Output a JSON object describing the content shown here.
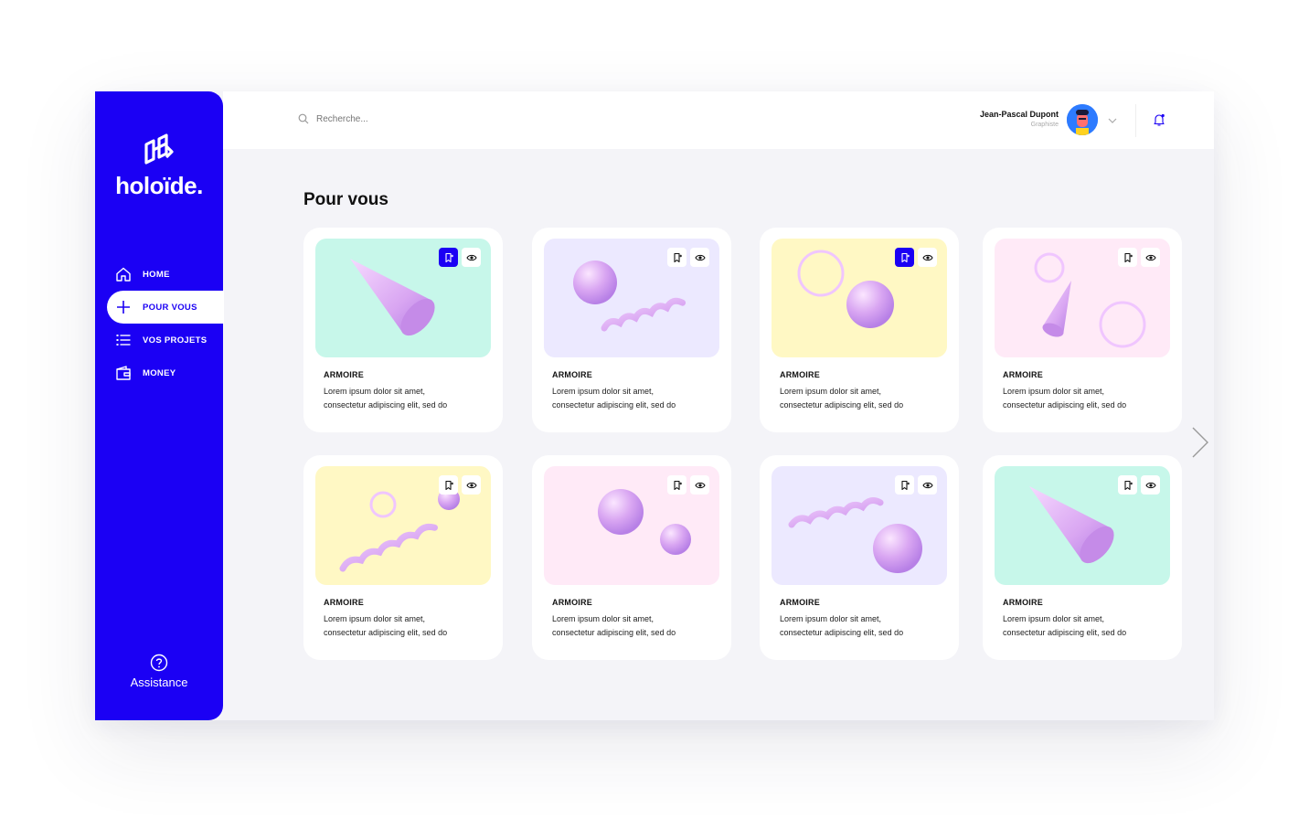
{
  "sidebar": {
    "logo_text": "holoïde.",
    "items": [
      {
        "label": "HOME",
        "icon": "home-icon",
        "active": false
      },
      {
        "label": "POUR VOUS",
        "icon": "plus-icon",
        "active": true
      },
      {
        "label": "VOS PROJETS",
        "icon": "list-icon",
        "active": false
      },
      {
        "label": "MONEY",
        "icon": "wallet-icon",
        "active": false
      }
    ],
    "assistance_label": "Assistance"
  },
  "header": {
    "search_placeholder": "Recherche...",
    "user_name": "Jean-Pascal Dupont",
    "user_role": "Graphiste"
  },
  "main": {
    "title": "Pour vous",
    "cards": [
      {
        "title": "ARMOIRE",
        "line1": "Lorem ipsum dolor sit amet,",
        "line2": "consectetur adipiscing elit, sed do",
        "bg": "#c7f7ea",
        "art": "cone",
        "saved": true
      },
      {
        "title": "ARMOIRE",
        "line1": "Lorem ipsum dolor sit amet,",
        "line2": "consectetur adipiscing elit, sed do",
        "bg": "#ece9ff",
        "art": "sphere-spiral",
        "saved": false
      },
      {
        "title": "ARMOIRE",
        "line1": "Lorem ipsum dolor sit amet,",
        "line2": "consectetur adipiscing elit, sed do",
        "bg": "#fff8c4",
        "art": "ring-sphere",
        "saved": true
      },
      {
        "title": "ARMOIRE",
        "line1": "Lorem ipsum dolor sit amet,",
        "line2": "consectetur adipiscing elit, sed do",
        "bg": "#ffeaf7",
        "art": "small-cone-rings",
        "saved": false
      },
      {
        "title": "ARMOIRE",
        "line1": "Lorem ipsum dolor sit amet,",
        "line2": "consectetur adipiscing elit, sed do",
        "bg": "#fff8c4",
        "art": "ring-spiral",
        "saved": false
      },
      {
        "title": "ARMOIRE",
        "line1": "Lorem ipsum dolor sit amet,",
        "line2": "consectetur adipiscing elit, sed do",
        "bg": "#ffeaf7",
        "art": "two-spheres",
        "saved": false
      },
      {
        "title": "ARMOIRE",
        "line1": "Lorem ipsum dolor sit amet,",
        "line2": "consectetur adipiscing elit, sed do",
        "bg": "#ece9ff",
        "art": "spiral-sphere",
        "saved": false
      },
      {
        "title": "ARMOIRE",
        "line1": "Lorem ipsum dolor sit amet,",
        "line2": "consectetur adipiscing elit, sed do",
        "bg": "#c7f7ea",
        "art": "cone",
        "saved": false
      }
    ]
  },
  "colors": {
    "brand": "#1b00f4",
    "shape": "#d9a6f2",
    "background": "#f4f4f8"
  }
}
